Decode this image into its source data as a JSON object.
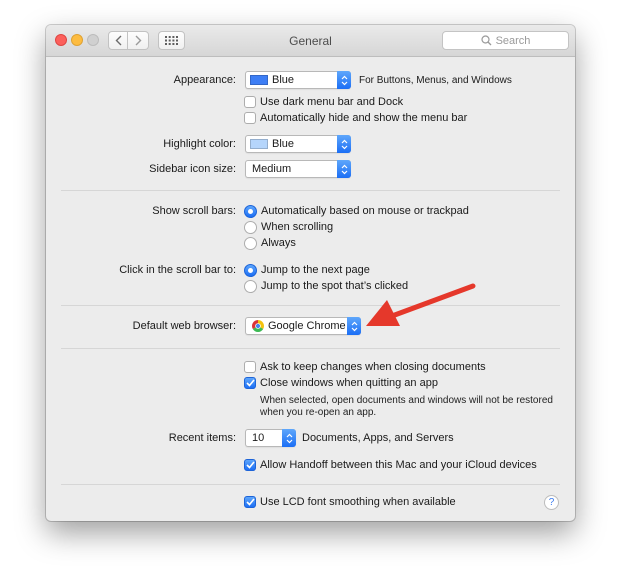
{
  "window": {
    "title": "General",
    "search_placeholder": "Search"
  },
  "appearance": {
    "label": "Appearance:",
    "value": "Blue",
    "swatch_color": "#3d7ef5",
    "hint": "For Buttons, Menus, and Windows",
    "dark_menu_label": "Use dark menu bar and Dock",
    "dark_menu_checked": false,
    "autohide_label": "Automatically hide and show the menu bar",
    "autohide_checked": false
  },
  "highlight": {
    "label": "Highlight color:",
    "value": "Blue",
    "swatch_color": "#b5d5fb"
  },
  "sidebar_icon": {
    "label": "Sidebar icon size:",
    "value": "Medium"
  },
  "scroll_bars": {
    "label": "Show scroll bars:",
    "options": [
      {
        "label": "Automatically based on mouse or trackpad",
        "selected": true
      },
      {
        "label": "When scrolling",
        "selected": false
      },
      {
        "label": "Always",
        "selected": false
      }
    ]
  },
  "scroll_click": {
    "label": "Click in the scroll bar to:",
    "options": [
      {
        "label": "Jump to the next page",
        "selected": true
      },
      {
        "label": "Jump to the spot that’s clicked",
        "selected": false
      }
    ]
  },
  "browser": {
    "label": "Default web browser:",
    "value": "Google Chrome",
    "icon": "chrome-icon"
  },
  "documents": {
    "ask_label": "Ask to keep changes when closing documents",
    "ask_checked": false,
    "close_label": "Close windows when quitting an app",
    "close_checked": true,
    "note_line1": "When selected, open documents and windows will not be restored",
    "note_line2": "when you re-open an app."
  },
  "recent": {
    "label": "Recent items:",
    "value": "10",
    "suffix": "Documents, Apps, and Servers"
  },
  "handoff": {
    "label": "Allow Handoff between this Mac and your iCloud devices",
    "checked": true
  },
  "lcd": {
    "label": "Use LCD font smoothing when available",
    "checked": true
  },
  "help_label": "?",
  "colors": {
    "accent": "#1c6ff5",
    "arrow": "#e5382b"
  }
}
